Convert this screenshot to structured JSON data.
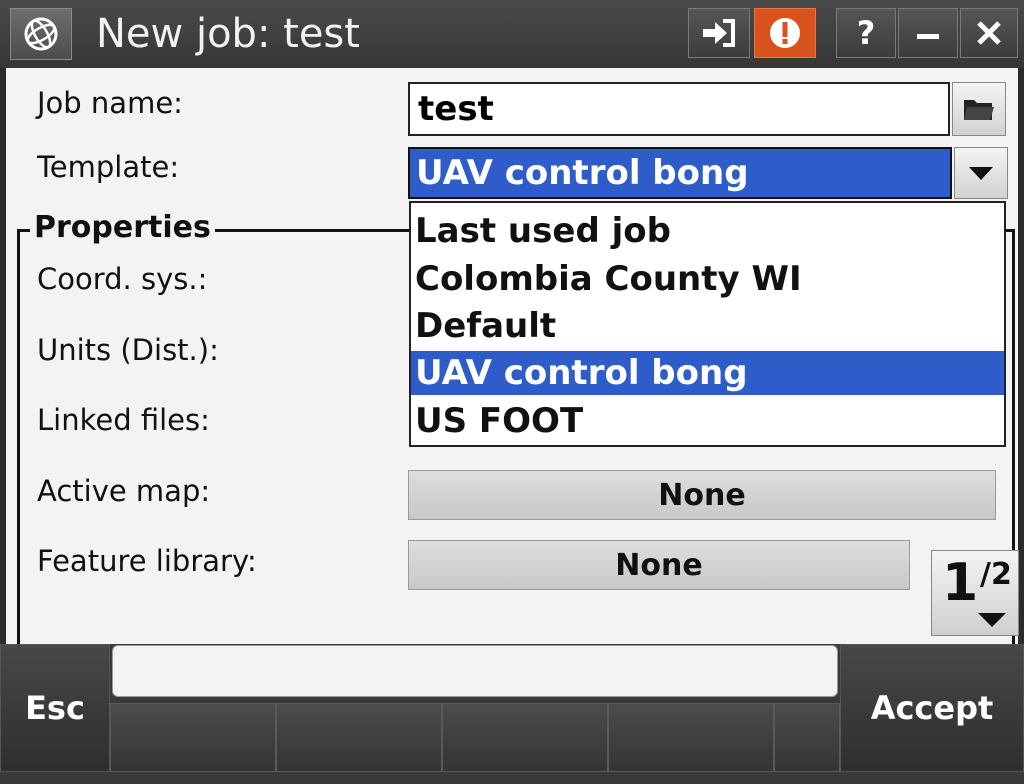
{
  "titlebar": {
    "title": "New job: test",
    "icons": [
      "trimble-globe-icon",
      "login-arrow-icon",
      "warning-icon",
      "help-icon",
      "minimize-icon",
      "close-icon"
    ],
    "help_label": "?",
    "warning_color": "#d8521c"
  },
  "form": {
    "job_name_label": "Job name:",
    "job_name_value": "test",
    "template_label": "Template:",
    "template_value": "UAV control bong"
  },
  "properties": {
    "legend": "Properties",
    "coord_sys_label": "Coord. sys.:",
    "units_label": "Units (Dist.):",
    "linked_files_label": "Linked files:",
    "active_map_label": "Active map:",
    "active_map_value": "None",
    "feature_library_label": "Feature library:",
    "feature_library_value": "None"
  },
  "template_dropdown": {
    "options": [
      "Last used job",
      "Colombia County WI",
      "Default",
      "UAV control bong",
      "US FOOT"
    ],
    "selected": "UAV control bong"
  },
  "pager": {
    "current": "1",
    "total": "2"
  },
  "softkeys": {
    "esc": "Esc",
    "accept": "Accept"
  },
  "colors": {
    "accent": "#2e5cc8",
    "background": "#f3f3f3",
    "chrome": "#3a3a3a"
  }
}
